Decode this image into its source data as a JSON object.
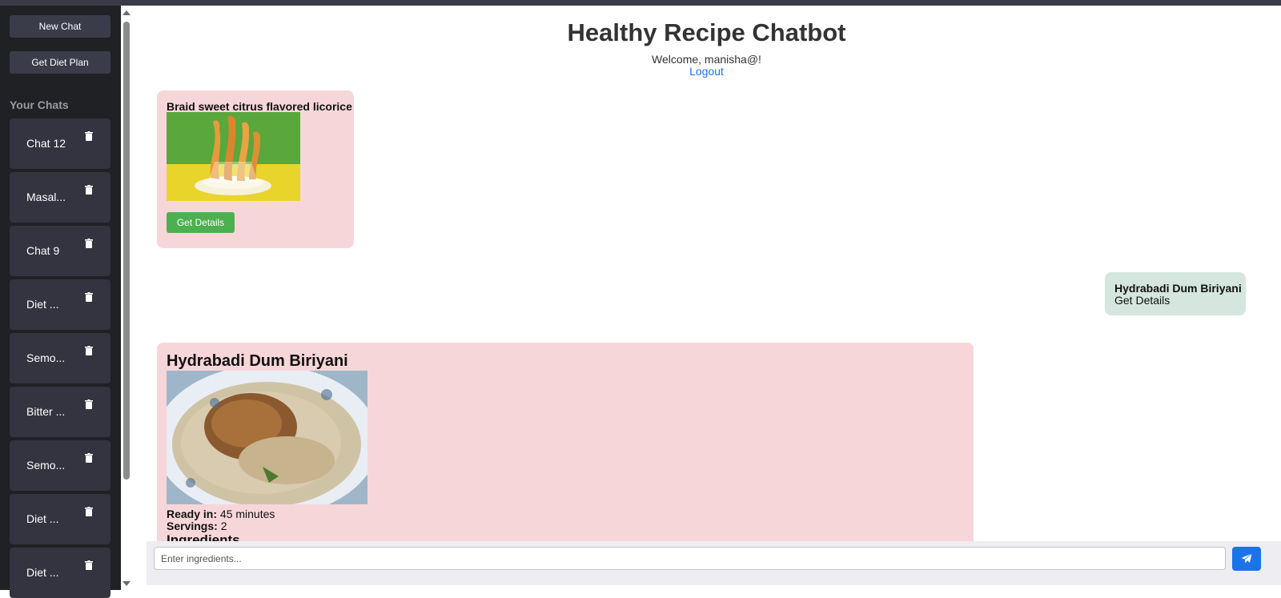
{
  "sidebar": {
    "new_chat_label": "New Chat",
    "diet_plan_label": "Get Diet Plan",
    "section_title": "Your Chats",
    "chats": [
      {
        "label": "Chat 12"
      },
      {
        "label": "Masal..."
      },
      {
        "label": "Chat 9"
      },
      {
        "label": "Diet ..."
      },
      {
        "label": "Semo..."
      },
      {
        "label": "Bitter ..."
      },
      {
        "label": "Semo..."
      },
      {
        "label": "Diet ..."
      },
      {
        "label": "Diet ..."
      }
    ],
    "delete_icon": "trash-icon"
  },
  "header": {
    "title": "Healthy Recipe Chatbot",
    "welcome": "Welcome, manisha@!",
    "logout_label": "Logout"
  },
  "messages": {
    "card1": {
      "title": "Braid sweet citrus flavored licorice",
      "button_label": "Get Details"
    },
    "user": {
      "recipe": "Hydrabadi Dum Biriyani",
      "action": "Get Details"
    },
    "card2": {
      "title": "Hydrabadi Dum Biriyani",
      "ready_label": "Ready in:",
      "ready_value": "45 minutes",
      "servings_label": "Servings:",
      "servings_value": "2",
      "ingredients_heading": "Ingredients"
    }
  },
  "composer": {
    "placeholder": "Enter ingredients...",
    "send_icon": "paper-plane-icon"
  },
  "colors": {
    "sidebar_bg": "#202124",
    "bot_bubble": "#f7d6da",
    "user_bubble": "#d4e6dd",
    "accent": "#1a73e8",
    "details_button": "#4caf50"
  }
}
